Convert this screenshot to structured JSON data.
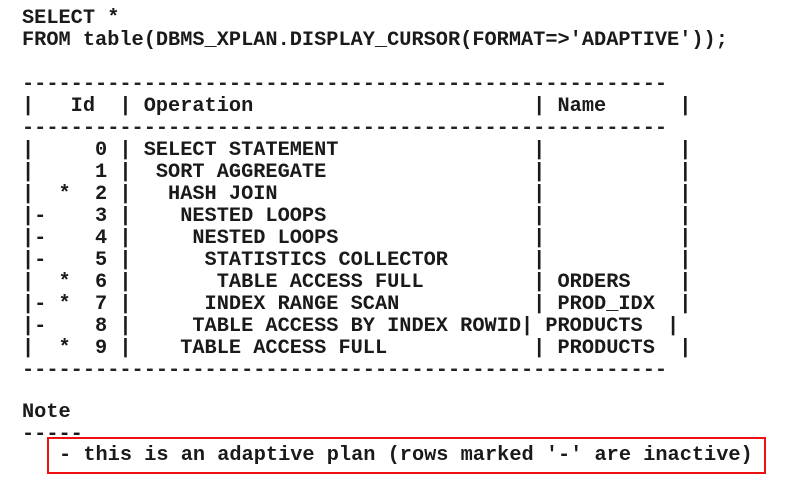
{
  "query": {
    "line1": "SELECT *",
    "line2": "FROM table(DBMS_XPLAN.DISPLAY_CURSOR(FORMAT=>'ADAPTIVE'));"
  },
  "plan_table": {
    "separator": "-----------------------------------------------------",
    "header": "|   Id  | Operation                       | Name      |",
    "columns": [
      "Id",
      "Operation",
      "Name"
    ],
    "rows": [
      {
        "marker": " ",
        "predicate": " ",
        "id": "0",
        "operation": "SELECT STATEMENT",
        "name": "",
        "text": "|     0 | SELECT STATEMENT                |           |"
      },
      {
        "marker": " ",
        "predicate": " ",
        "id": "1",
        "operation": " SORT AGGREGATE",
        "name": "",
        "text": "|     1 |  SORT AGGREGATE                 |           |"
      },
      {
        "marker": " ",
        "predicate": "*",
        "id": "2",
        "operation": "  HASH JOIN",
        "name": "",
        "text": "|  *  2 |   HASH JOIN                     |           |"
      },
      {
        "marker": "-",
        "predicate": " ",
        "id": "3",
        "operation": "   NESTED LOOPS",
        "name": "",
        "text": "|-    3 |    NESTED LOOPS                 |           |"
      },
      {
        "marker": "-",
        "predicate": " ",
        "id": "4",
        "operation": "    NESTED LOOPS",
        "name": "",
        "text": "|-    4 |     NESTED LOOPS                |           |"
      },
      {
        "marker": "-",
        "predicate": " ",
        "id": "5",
        "operation": "     STATISTICS COLLECTOR",
        "name": "",
        "text": "|-    5 |      STATISTICS COLLECTOR       |           |"
      },
      {
        "marker": " ",
        "predicate": "*",
        "id": "6",
        "operation": "      TABLE ACCESS FULL",
        "name": "ORDERS",
        "text": "|  *  6 |       TABLE ACCESS FULL         | ORDERS    |"
      },
      {
        "marker": "-",
        "predicate": "*",
        "id": "7",
        "operation": "     INDEX RANGE SCAN",
        "name": "PROD_IDX",
        "text": "|- *  7 |      INDEX RANGE SCAN           | PROD_IDX  |"
      },
      {
        "marker": "-",
        "predicate": " ",
        "id": "8",
        "operation": "    TABLE ACCESS BY INDEX ROWID",
        "name": "PRODUCTS",
        "text": "|-    8 |     TABLE ACCESS BY INDEX ROWID| PRODUCTS  |"
      },
      {
        "marker": " ",
        "predicate": "*",
        "id": "9",
        "operation": "   TABLE ACCESS FULL",
        "name": "PRODUCTS",
        "text": "|  *  9 |    TABLE ACCESS FULL            | PRODUCTS  |"
      }
    ]
  },
  "note": {
    "title": "Note",
    "underline": "-----",
    "text": "- this is an adaptive plan (rows marked '-' are inactive)",
    "highlight_color": "#ee1111"
  }
}
